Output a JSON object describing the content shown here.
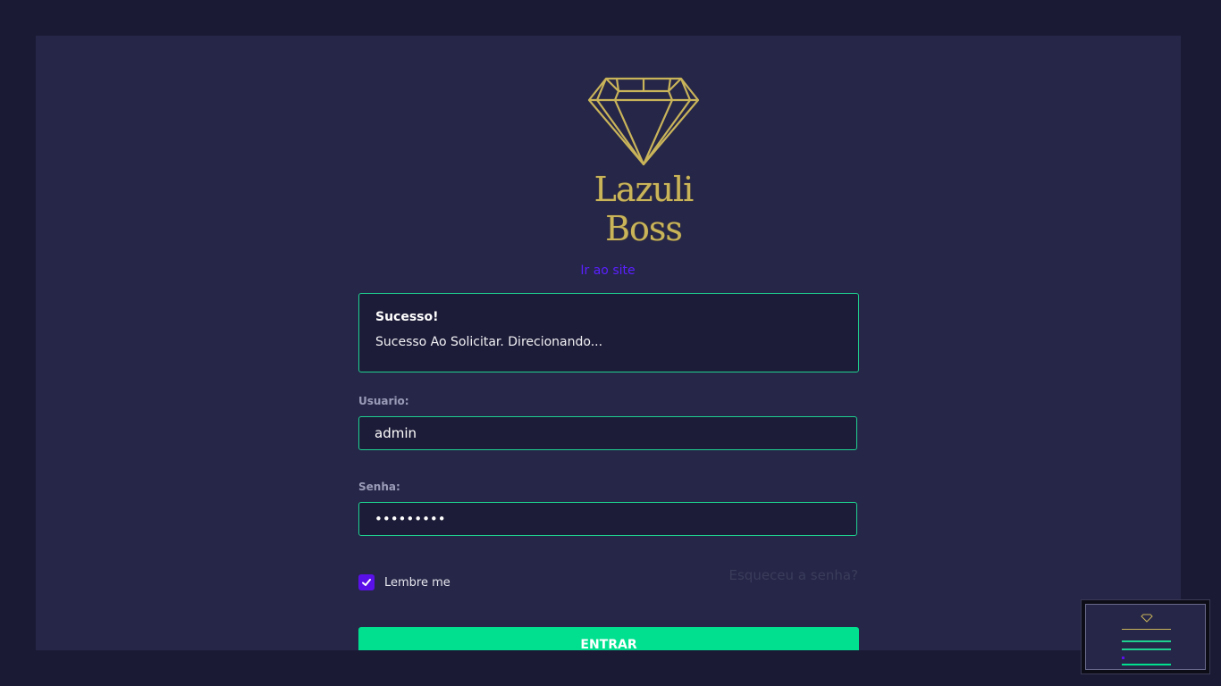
{
  "brand": {
    "name": "Lazuli Boss",
    "logo_icon": "diamond-icon",
    "accent": "#c9b45a"
  },
  "site_link": "Ir ao site",
  "alert": {
    "title": "Sucesso!",
    "message": "Sucesso Ao Solicitar. Direcionando..."
  },
  "form": {
    "user_label": "Usuario:",
    "user_value": "admin",
    "password_label": "Senha:",
    "password_value": "•••••••••",
    "remember_label": "Lembre me",
    "remember_checked": true,
    "forgot_label": "Esqueceu a senha?",
    "submit_label": "ENTRAR"
  },
  "colors": {
    "background": "#1b1a35",
    "panel": "#262648",
    "success": "#1ed18f",
    "button": "#00e08f",
    "link": "#5a20ff",
    "checkbox": "#5a10e8"
  }
}
